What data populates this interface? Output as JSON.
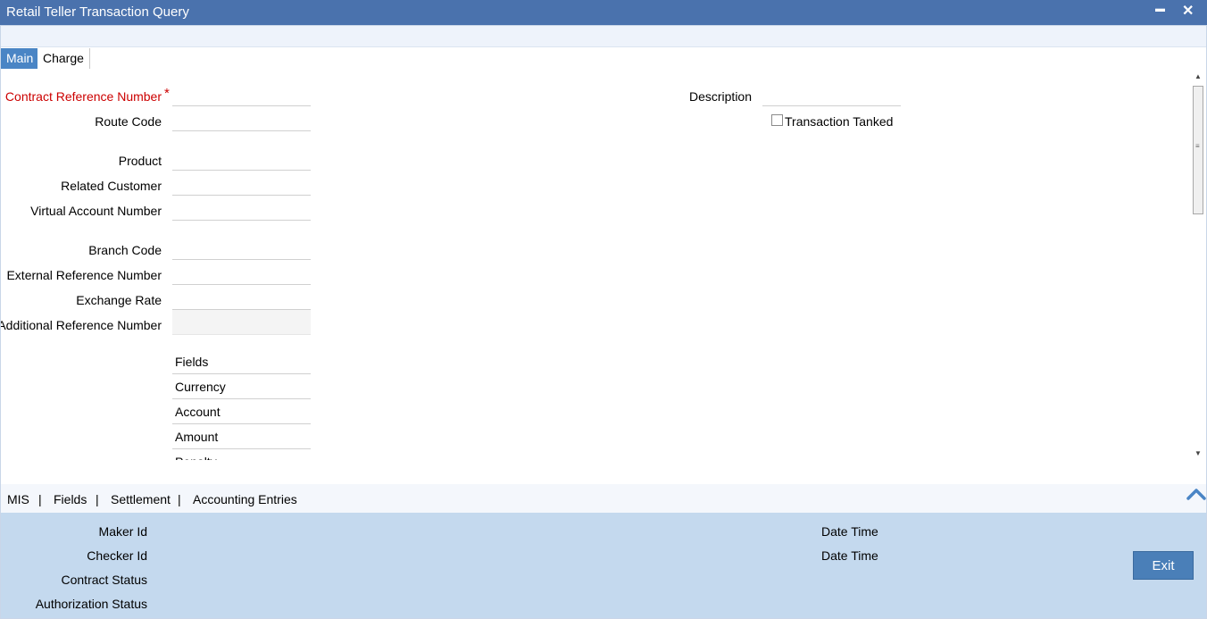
{
  "window": {
    "title": "Retail Teller Transaction Query",
    "minimize_glyph": "▬",
    "close_glyph": "✕"
  },
  "tabs": [
    {
      "label": "Main"
    },
    {
      "label": "Charge"
    }
  ],
  "form": {
    "left_labels": {
      "contract_ref": "Contract Reference Number",
      "required_mark": "*",
      "route_code": "Route Code",
      "product": "Product",
      "related_customer": "Related Customer",
      "virtual_account": "Virtual Account Number",
      "branch_code": "Branch Code",
      "external_ref": "External Reference Number",
      "exchange_rate": "Exchange Rate",
      "additional_ref": "Additional Reference Number"
    },
    "right_labels": {
      "description": "Description",
      "transaction_tanked": "Transaction Tanked"
    },
    "fields_grid": [
      {
        "label": "Fields"
      },
      {
        "label": "Currency"
      },
      {
        "label": "Account"
      },
      {
        "label": "Amount"
      },
      {
        "label": "Penalty"
      }
    ]
  },
  "footer_links": [
    {
      "label": "MIS"
    },
    {
      "label": "Fields"
    },
    {
      "label": "Settlement"
    },
    {
      "label": "Accounting Entries"
    }
  ],
  "footer_sep": "|",
  "audit": {
    "maker_id": "Maker Id",
    "checker_id": "Checker Id",
    "contract_status": "Contract Status",
    "authorization_status": "Authorization Status",
    "date_time_1": "Date Time",
    "date_time_2": "Date Time"
  },
  "buttons": {
    "exit": "Exit"
  },
  "colors": {
    "title_bar": "#4a72ad",
    "active_tab": "#4a85c5",
    "required": "#cc0000",
    "audit_bg": "#c4d9ee",
    "exit_button": "#4a7fb8"
  }
}
